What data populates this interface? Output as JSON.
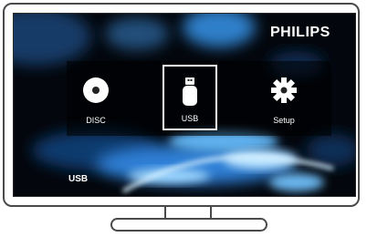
{
  "brand": {
    "name": "PHILIPS"
  },
  "menu": {
    "items": [
      {
        "label": "DISC",
        "icon": "disc-icon"
      },
      {
        "label": "USB",
        "icon": "usb-drive-icon",
        "selected": true
      },
      {
        "label": "Setup",
        "icon": "gear-icon"
      }
    ]
  },
  "status": {
    "source": "USB"
  },
  "colors": {
    "screen_bg": "#03060c",
    "aurora": "#2f7fd6",
    "text": "#ffffff",
    "frame": "#4a4a4a"
  }
}
